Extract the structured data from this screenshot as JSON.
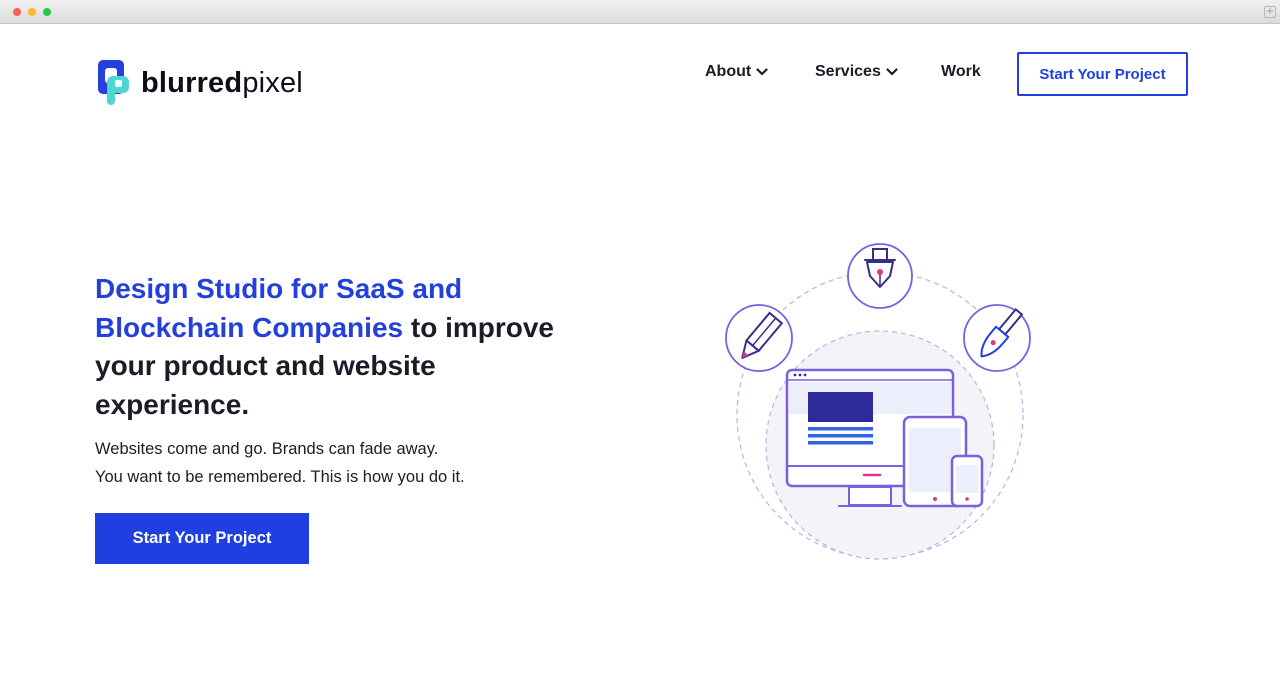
{
  "browser": {
    "new_tab_symbol": "+"
  },
  "header": {
    "logo": {
      "icon": "bp-logo-icon",
      "bold": "blurred",
      "light": "pixel"
    },
    "nav": {
      "about": "About",
      "services": "Services",
      "work": "Work"
    },
    "cta_label": "Start Your Project"
  },
  "hero": {
    "heading_accent": "Design Studio for SaaS and Blockchain Companies",
    "heading_rest": " to improve your product and website experience.",
    "sub_line1": "Websites come and go. Brands can fade away.",
    "sub_line2": "You want to be remembered. This is how you do it.",
    "cta_label": "Start Your Project",
    "illustration_icons": [
      "pencil-icon",
      "pen-nib-icon",
      "brush-icon",
      "desktop-monitor-icon",
      "tablet-icon",
      "phone-icon"
    ]
  },
  "colors": {
    "brand_blue": "#1f3fe0",
    "accent_text": "#2440dc",
    "illustration_purple": "#7b5fe0",
    "logo_teal": "#4fd6cf"
  }
}
